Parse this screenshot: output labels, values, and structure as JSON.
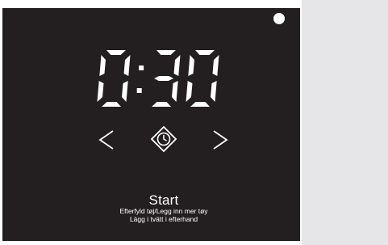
{
  "display": {
    "time": "0:30",
    "digits": [
      "0",
      ":",
      "3",
      "0"
    ],
    "background_color": "#231f20",
    "foreground_color": "#ffffff",
    "side_panel_color": "#e6e6e8"
  },
  "controls": {
    "previous_icon": "chevron-left-icon",
    "timer_icon": "clock-diamond-icon",
    "next_icon": "chevron-right-icon"
  },
  "start": {
    "label": "Start",
    "line1": "Efterfyld tøj/Legg inn mer tøy",
    "line2": "Lägg i tvätt i efterhand"
  }
}
